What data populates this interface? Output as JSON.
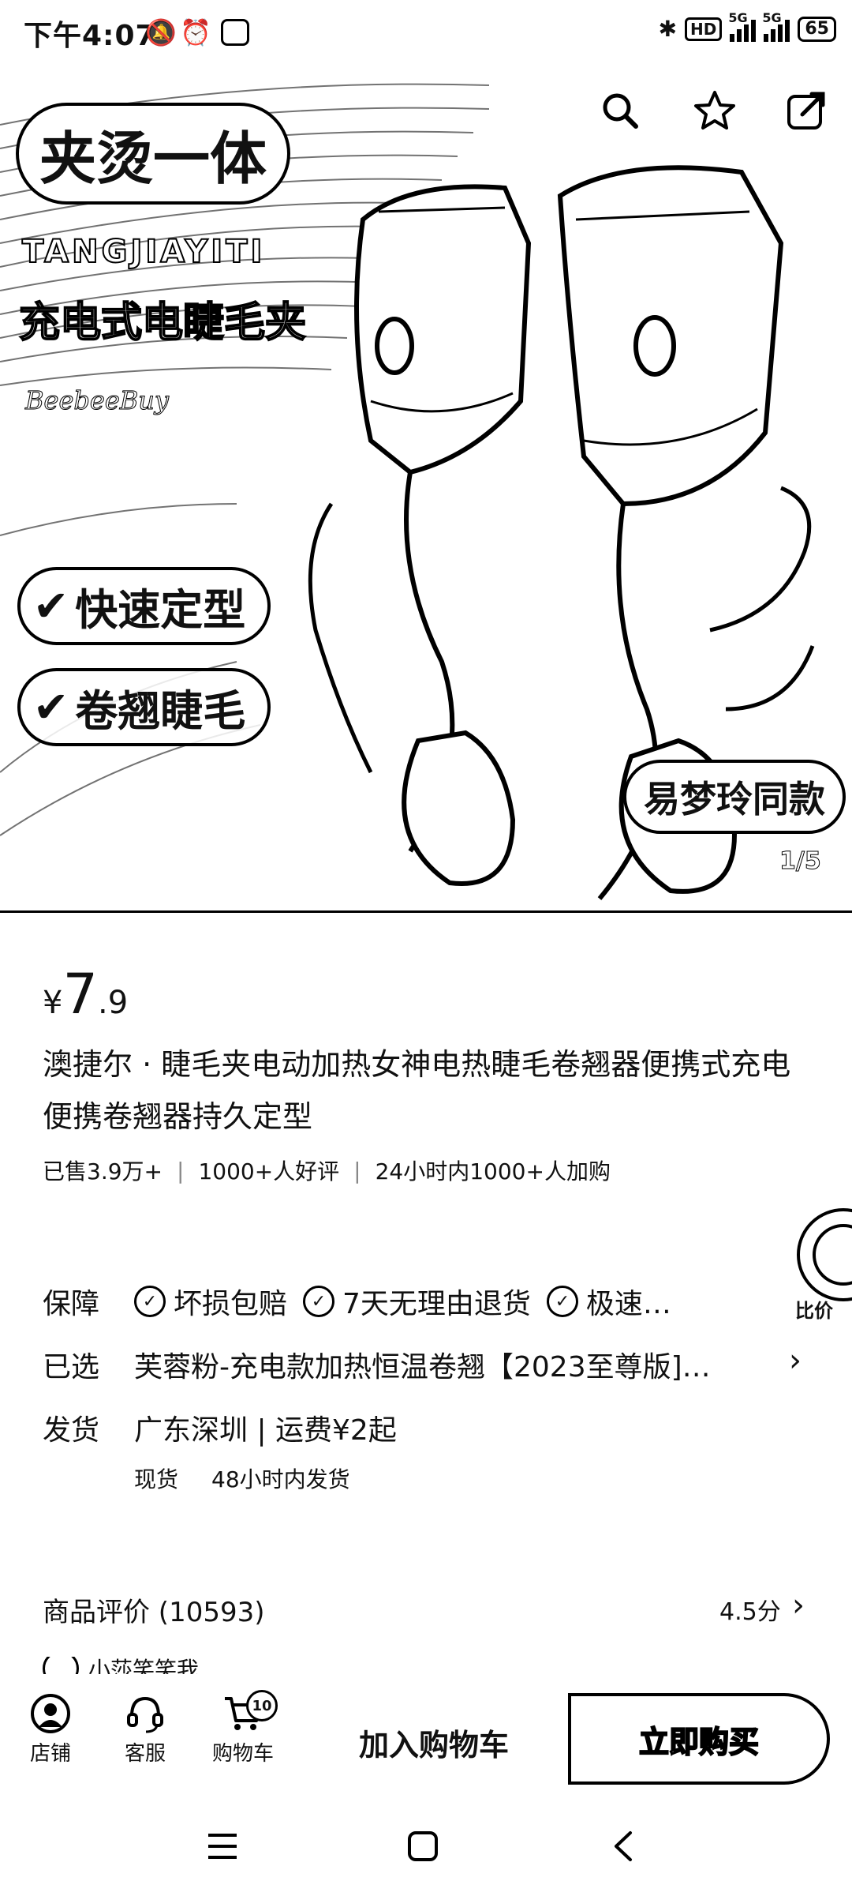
{
  "status_bar": {
    "time": "下午4:07",
    "hd": "HD",
    "network_1": "5G",
    "network_2": "5G",
    "battery": "65"
  },
  "hero": {
    "title_badge": "夹烫一体",
    "pinyin": "TANGJIAYITI",
    "subtitle": "充电式电睫毛夹",
    "brand": "BeebeeBuy",
    "tags": [
      "快速定型",
      "卷翘睫毛"
    ],
    "endorsement": "易梦玲同款",
    "counter": "1/5"
  },
  "product": {
    "price_currency": "¥",
    "price_integer": "7",
    "price_decimal": ".9",
    "title": "澳捷尔 · 睫毛夹电动加热女神电热睫毛卷翘器便携式充电便携卷翘器持久定型",
    "stats": [
      "已售3.9万+",
      "1000+人好评",
      "24小时内1000+人加购"
    ],
    "float_badge_label": "比价"
  },
  "guarantee": {
    "label": "保障",
    "items": [
      "坏损包赔",
      "7天无理由退货",
      "极速…"
    ]
  },
  "selected": {
    "label": "已选",
    "value": "芙蓉粉-充电款加热恒温卷翘【2023至尊版]…"
  },
  "shipping": {
    "label": "发货",
    "value": "广东深圳 | 运费¥2起",
    "stock": "现货",
    "dispatch": "48小时内发货"
  },
  "reviews": {
    "title": "商品评价 (10593)",
    "score": "4.5分",
    "first_reviewer": "小莎笑笑我"
  },
  "bottom_bar": {
    "shop": "店铺",
    "service": "客服",
    "cart": "购物车",
    "cart_count": "10",
    "add_to_cart": "加入购物车",
    "buy_now": "立即购买"
  }
}
